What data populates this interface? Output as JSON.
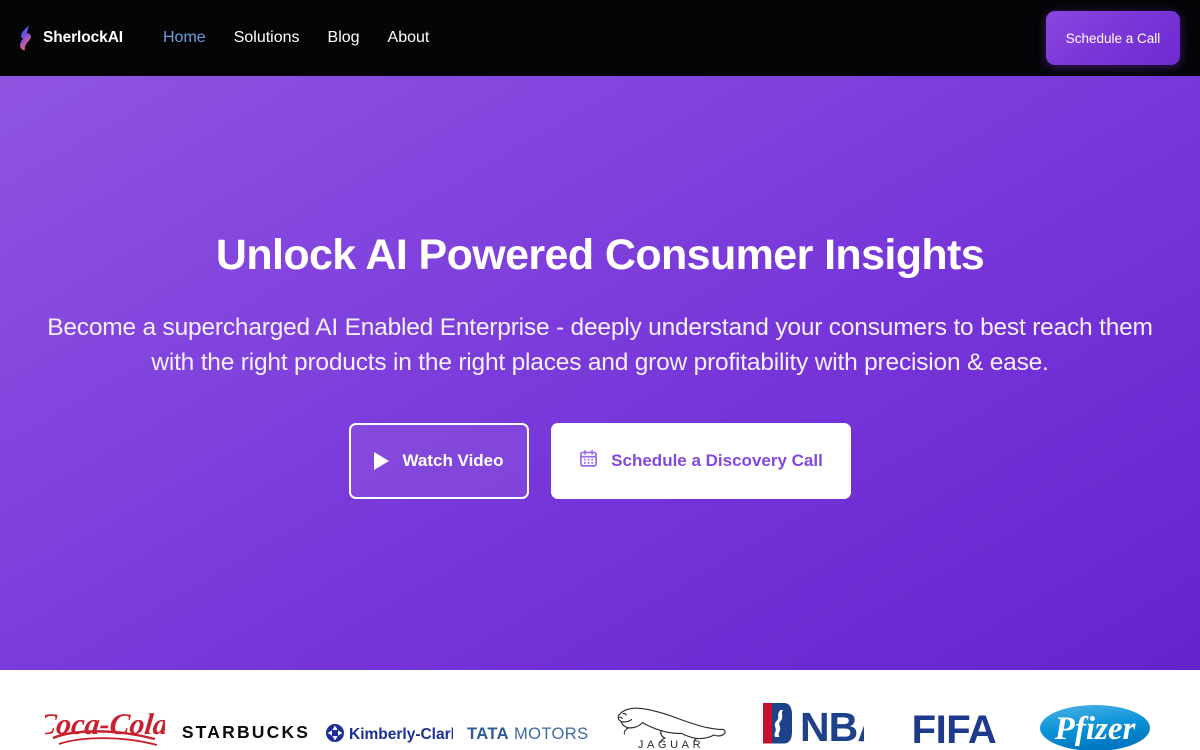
{
  "nav": {
    "logo_icon": "sherlock-flame-logo",
    "brand_prefix": "Sherlock",
    "brand_suffix": "AI",
    "links": [
      {
        "label": "Home",
        "active": true
      },
      {
        "label": "Solutions",
        "active": false
      },
      {
        "label": "Blog",
        "active": false
      },
      {
        "label": "About",
        "active": false
      }
    ],
    "cta_label": "Schedule a Call"
  },
  "hero": {
    "title": "Unlock AI Powered Consumer Insights",
    "subtitle": "Become a supercharged AI Enabled Enterprise - deeply understand your consumers to best reach them with the right products in the right places and grow profitability with precision & ease.",
    "primary_button": {
      "label": "Watch Video",
      "icon": "play-icon"
    },
    "secondary_button": {
      "label": "Schedule a Discovery Call",
      "icon": "calendar-icon"
    }
  },
  "logo_strip": {
    "logos": [
      {
        "name": "Coca-Cola",
        "text": "Coca-Cola",
        "color": "#c8202e"
      },
      {
        "name": "Starbucks",
        "text": "STARBUCKS",
        "color": "#0a0a0a"
      },
      {
        "name": "Kimberly-Clark",
        "text": "Kimberly-Clark",
        "color": "#1c2f94"
      },
      {
        "name": "Tata Motors",
        "text": "TATA MOTORS",
        "color": "#3c6ba5"
      },
      {
        "name": "Jaguar",
        "text": "JAGUAR",
        "color": "#2b2b2b"
      },
      {
        "name": "NBA",
        "text": "NBA",
        "color": "#1d428a"
      },
      {
        "name": "FIFA",
        "text": "FIFA",
        "color": "#1d3a8f"
      },
      {
        "name": "Pfizer",
        "text": "Pfizer",
        "color": "#0093d0"
      }
    ]
  },
  "colors": {
    "navbar_bg": "#050508",
    "hero_gradient_start": "#8e54e0",
    "hero_gradient_end": "#6424cd",
    "nav_active": "#6d9fe0",
    "accent_purple": "#8348df"
  }
}
